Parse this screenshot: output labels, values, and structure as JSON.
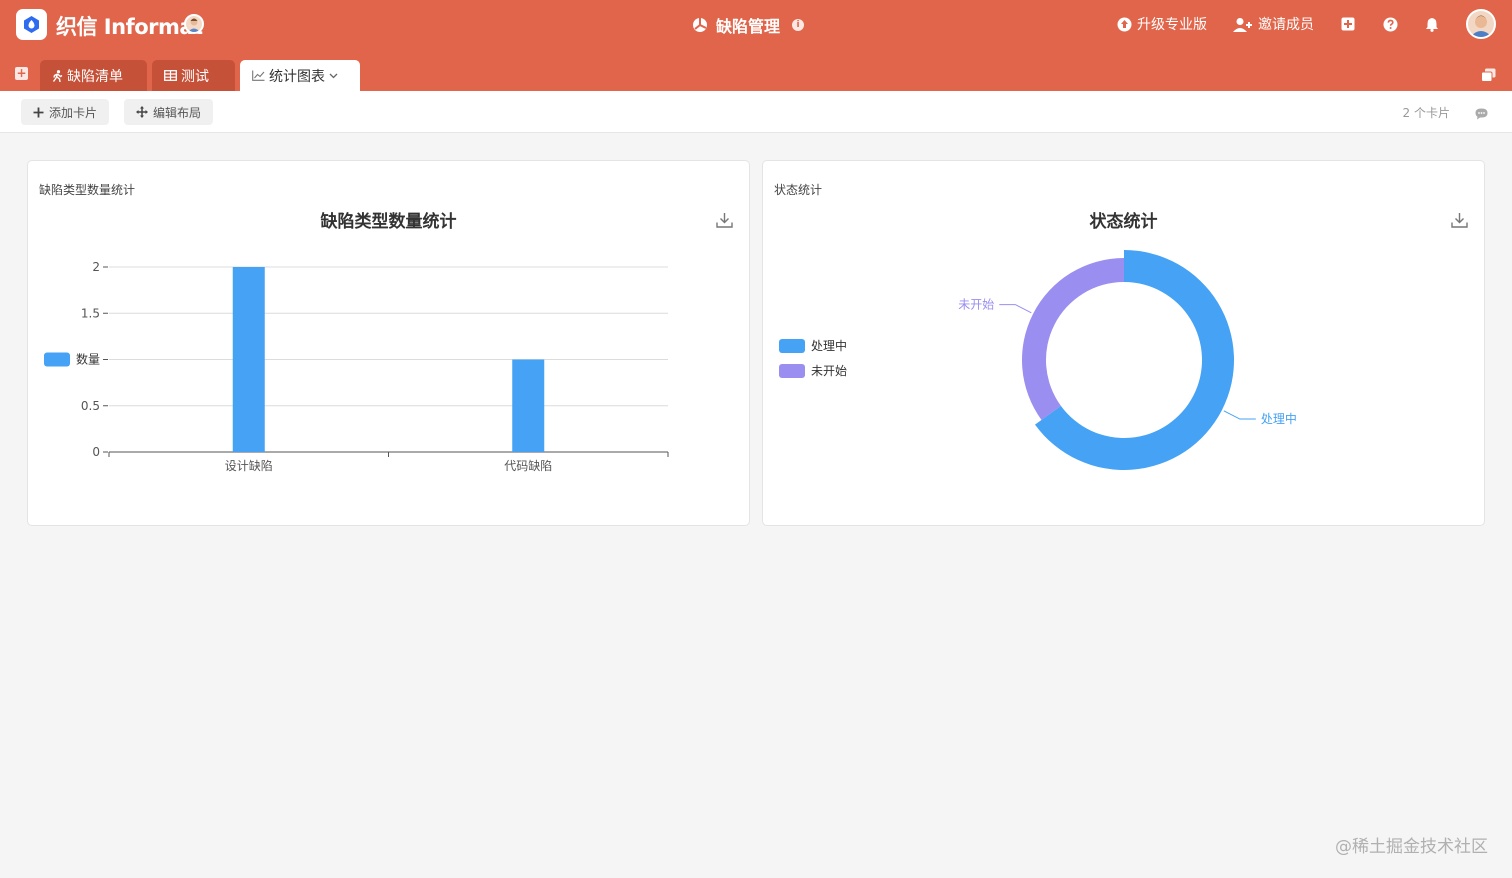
{
  "header": {
    "brand": "织信 Informat",
    "app_title": "缺陷管理",
    "upgrade_label": "升级专业版",
    "invite_label": "邀请成员"
  },
  "tabs": [
    {
      "label": "缺陷清单"
    },
    {
      "label": "测试"
    },
    {
      "label": "统计图表"
    }
  ],
  "toolbar": {
    "add_card_label": "添加卡片",
    "edit_layout_label": "编辑布局",
    "card_count": "2 个卡片"
  },
  "cards": [
    {
      "name": "缺陷类型数量统计"
    },
    {
      "name": "状态统计"
    }
  ],
  "chart_data": [
    {
      "type": "bar",
      "title": "缺陷类型数量统计",
      "categories": [
        "设计缺陷",
        "代码缺陷"
      ],
      "series": [
        {
          "name": "数量",
          "values": [
            2,
            1
          ],
          "color": "#45a2f5"
        }
      ],
      "yticks": [
        0,
        0.5,
        1,
        1.5,
        2
      ],
      "ytick_labels": [
        "0",
        "0.5",
        "",
        "1.5",
        "2"
      ],
      "ylim": [
        0,
        2
      ],
      "grid": true,
      "legend_position": "left"
    },
    {
      "type": "pie",
      "title": "状态统计",
      "donut": true,
      "slices": [
        {
          "label": "处理中",
          "value": 65,
          "color": "#45a2f5"
        },
        {
          "label": "未开始",
          "value": 35,
          "color": "#9a8ef0"
        }
      ],
      "legend_position": "left"
    }
  ],
  "watermark": "@稀土掘金技术社区"
}
